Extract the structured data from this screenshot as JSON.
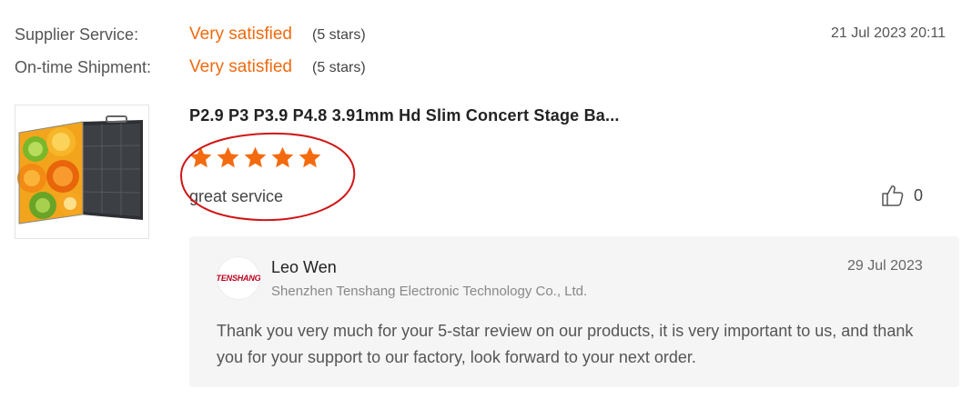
{
  "ratings": [
    {
      "label": "Supplier Service:",
      "value": "Very satisfied",
      "stars": "(5 stars)"
    },
    {
      "label": "On-time Shipment:",
      "value": "Very satisfied",
      "stars": "(5 stars)"
    }
  ],
  "review": {
    "date": "21 Jul 2023 20:11",
    "product_title": "P2.9 P3 P3.9 P4.8 3.91mm Hd Slim Concert Stage Ba...",
    "rating": 5,
    "star_color": "#f46b0f",
    "text": "great service",
    "likes": "0",
    "annotation_color": "#d01515"
  },
  "reply": {
    "logo_text": "TENSHANG",
    "name": "Leo Wen",
    "company": "Shenzhen Tenshang Electronic Technology Co., Ltd.",
    "date": "29 Jul 2023",
    "text": "Thank you very much for your 5-star review on our products, it is very important to us, and thank you for your support to our factory, look forward to your next order."
  },
  "colors": {
    "accent_orange": "#f06a0f",
    "reply_bg": "#f5f5f6"
  }
}
